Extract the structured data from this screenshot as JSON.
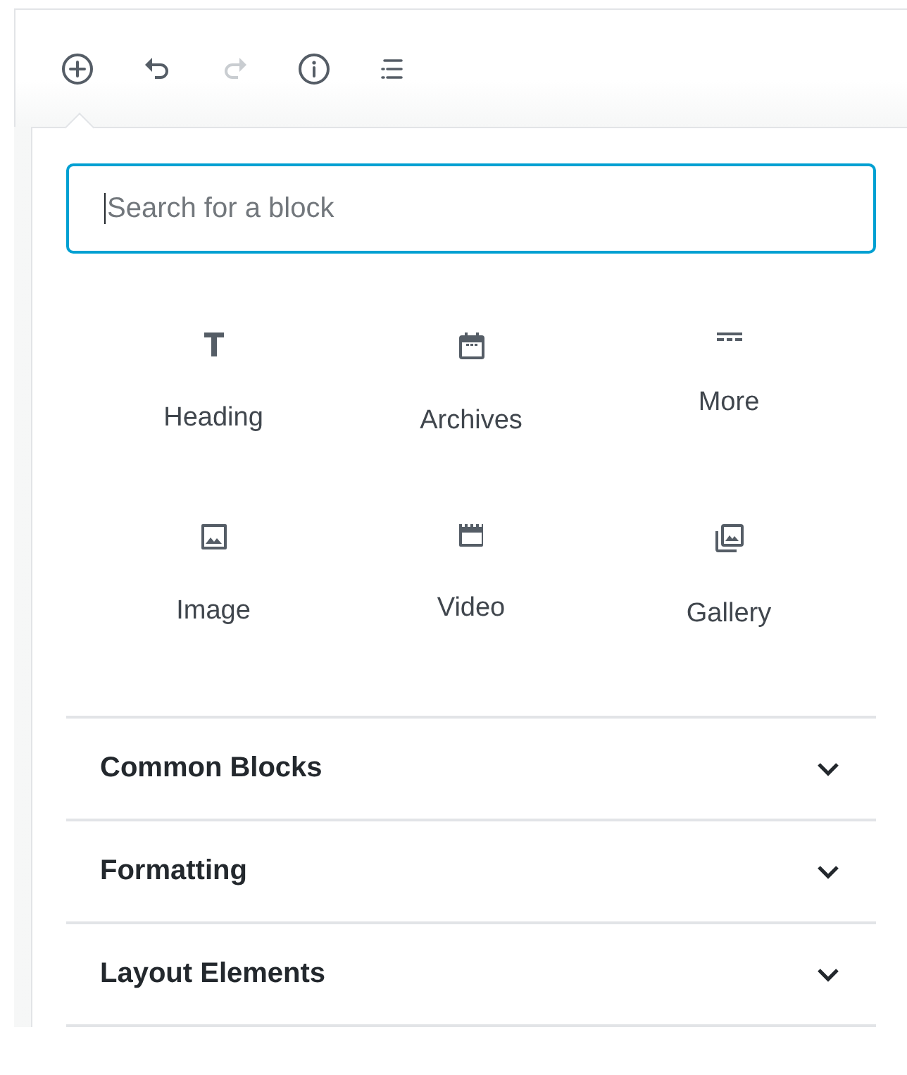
{
  "toolbar": [
    {
      "kind": "add",
      "disabled": false
    },
    {
      "kind": "undo",
      "disabled": false
    },
    {
      "kind": "redo",
      "disabled": true
    },
    {
      "kind": "info",
      "disabled": false
    },
    {
      "kind": "outline",
      "disabled": false
    }
  ],
  "search": {
    "placeholder": "Search for a block"
  },
  "blocks": [
    {
      "kind": "heading",
      "label": "Heading"
    },
    {
      "kind": "archives",
      "label": "Archives"
    },
    {
      "kind": "more",
      "label": "More"
    },
    {
      "kind": "image",
      "label": "Image"
    },
    {
      "kind": "video",
      "label": "Video"
    },
    {
      "kind": "gallery",
      "label": "Gallery"
    }
  ],
  "sections": [
    {
      "title": "Common Blocks",
      "expanded": false
    },
    {
      "title": "Formatting",
      "expanded": false
    },
    {
      "title": "Layout Elements",
      "expanded": false
    }
  ]
}
